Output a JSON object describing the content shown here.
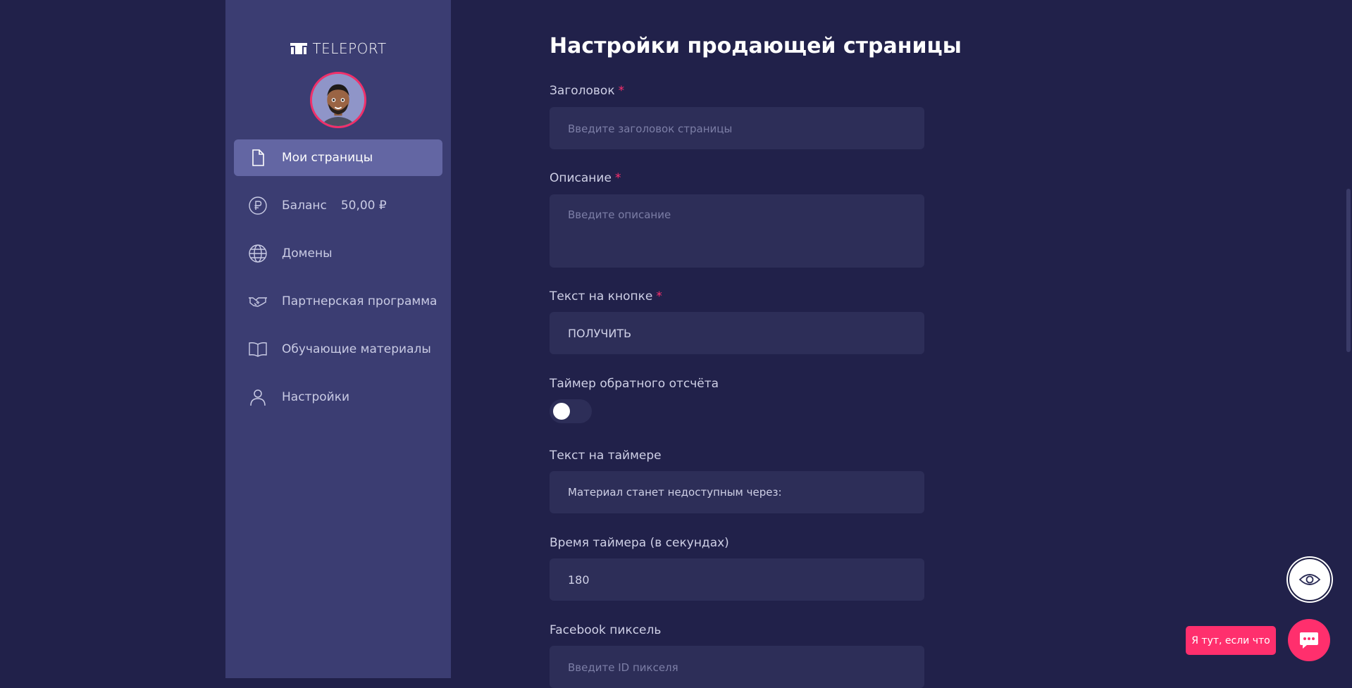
{
  "brand": {
    "logo_text": "TELEPORT"
  },
  "sidebar": {
    "items": [
      {
        "label": "Мои страницы",
        "icon": "file-icon",
        "active": true
      },
      {
        "label": "Баланс",
        "icon": "ruble-icon",
        "value": "50,00 ₽"
      },
      {
        "label": "Домены",
        "icon": "globe-icon"
      },
      {
        "label": "Партнерская программа",
        "icon": "handshake-icon"
      },
      {
        "label": "Обучающие материалы",
        "icon": "book-icon"
      },
      {
        "label": "Настройки",
        "icon": "user-icon"
      }
    ]
  },
  "main": {
    "title": "Настройки продающей страницы",
    "fields": {
      "heading": {
        "label": "Заголовок",
        "required": "*",
        "placeholder": "Введите заголовок страницы",
        "value": ""
      },
      "description": {
        "label": "Описание",
        "required": "*",
        "placeholder": "Введите описание",
        "value": ""
      },
      "button_text": {
        "label": "Текст на кнопке",
        "required": "*",
        "value": "ПОЛУЧИТЬ"
      },
      "timer": {
        "label": "Таймер обратного отсчёта",
        "enabled": false
      },
      "timer_text": {
        "label": "Текст на таймере",
        "value": "Материал станет недоступным через:"
      },
      "timer_time": {
        "label": "Время таймера (в секундах)",
        "value": "180"
      },
      "facebook_pixel": {
        "label": "Facebook пиксель",
        "placeholder": "Введите ID пикселя",
        "value": ""
      }
    }
  },
  "floating": {
    "preview_icon": "eye-icon",
    "chat_tooltip": "Я тут, если что",
    "chat_icon": "chat-icon"
  },
  "colors": {
    "background": "#21214a",
    "sidebar": "#3b3d72",
    "active_item": "#6366a3",
    "input": "#2d2e58",
    "accent": "#ff2f6d"
  }
}
